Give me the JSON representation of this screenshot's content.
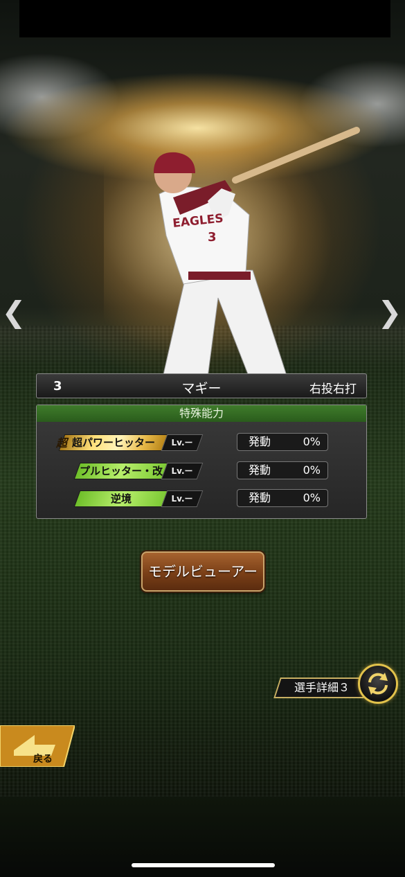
{
  "nav": {
    "prev_icon": "chevron-left-icon",
    "next_icon": "chevron-right-icon"
  },
  "player": {
    "number": "3",
    "name": "マギー",
    "throw_bat": "右投右打",
    "uniform_text": "EAGLES",
    "uniform_number": "3"
  },
  "abilities": {
    "header": "特殊能力",
    "items": [
      {
        "prefix": "超",
        "label": "超パワーヒッター",
        "level": "Lv.ー",
        "trigger_label": "発動",
        "trigger_value": "0%",
        "color": "gold"
      },
      {
        "prefix": "",
        "label": "プルヒッター・改",
        "level": "Lv.ー",
        "trigger_label": "発動",
        "trigger_value": "0%",
        "color": "green"
      },
      {
        "prefix": "",
        "label": "逆境",
        "level": "Lv.ー",
        "trigger_label": "発動",
        "trigger_value": "0%",
        "color": "green"
      }
    ]
  },
  "buttons": {
    "model_viewer": "モデルビューアー",
    "detail": "選手詳細３",
    "back": "戻る"
  },
  "colors": {
    "ability_header": "#2f6a22",
    "gold": "#f4cf5c",
    "green": "#9bdc4e",
    "button_brown": "#8a4a1c"
  }
}
